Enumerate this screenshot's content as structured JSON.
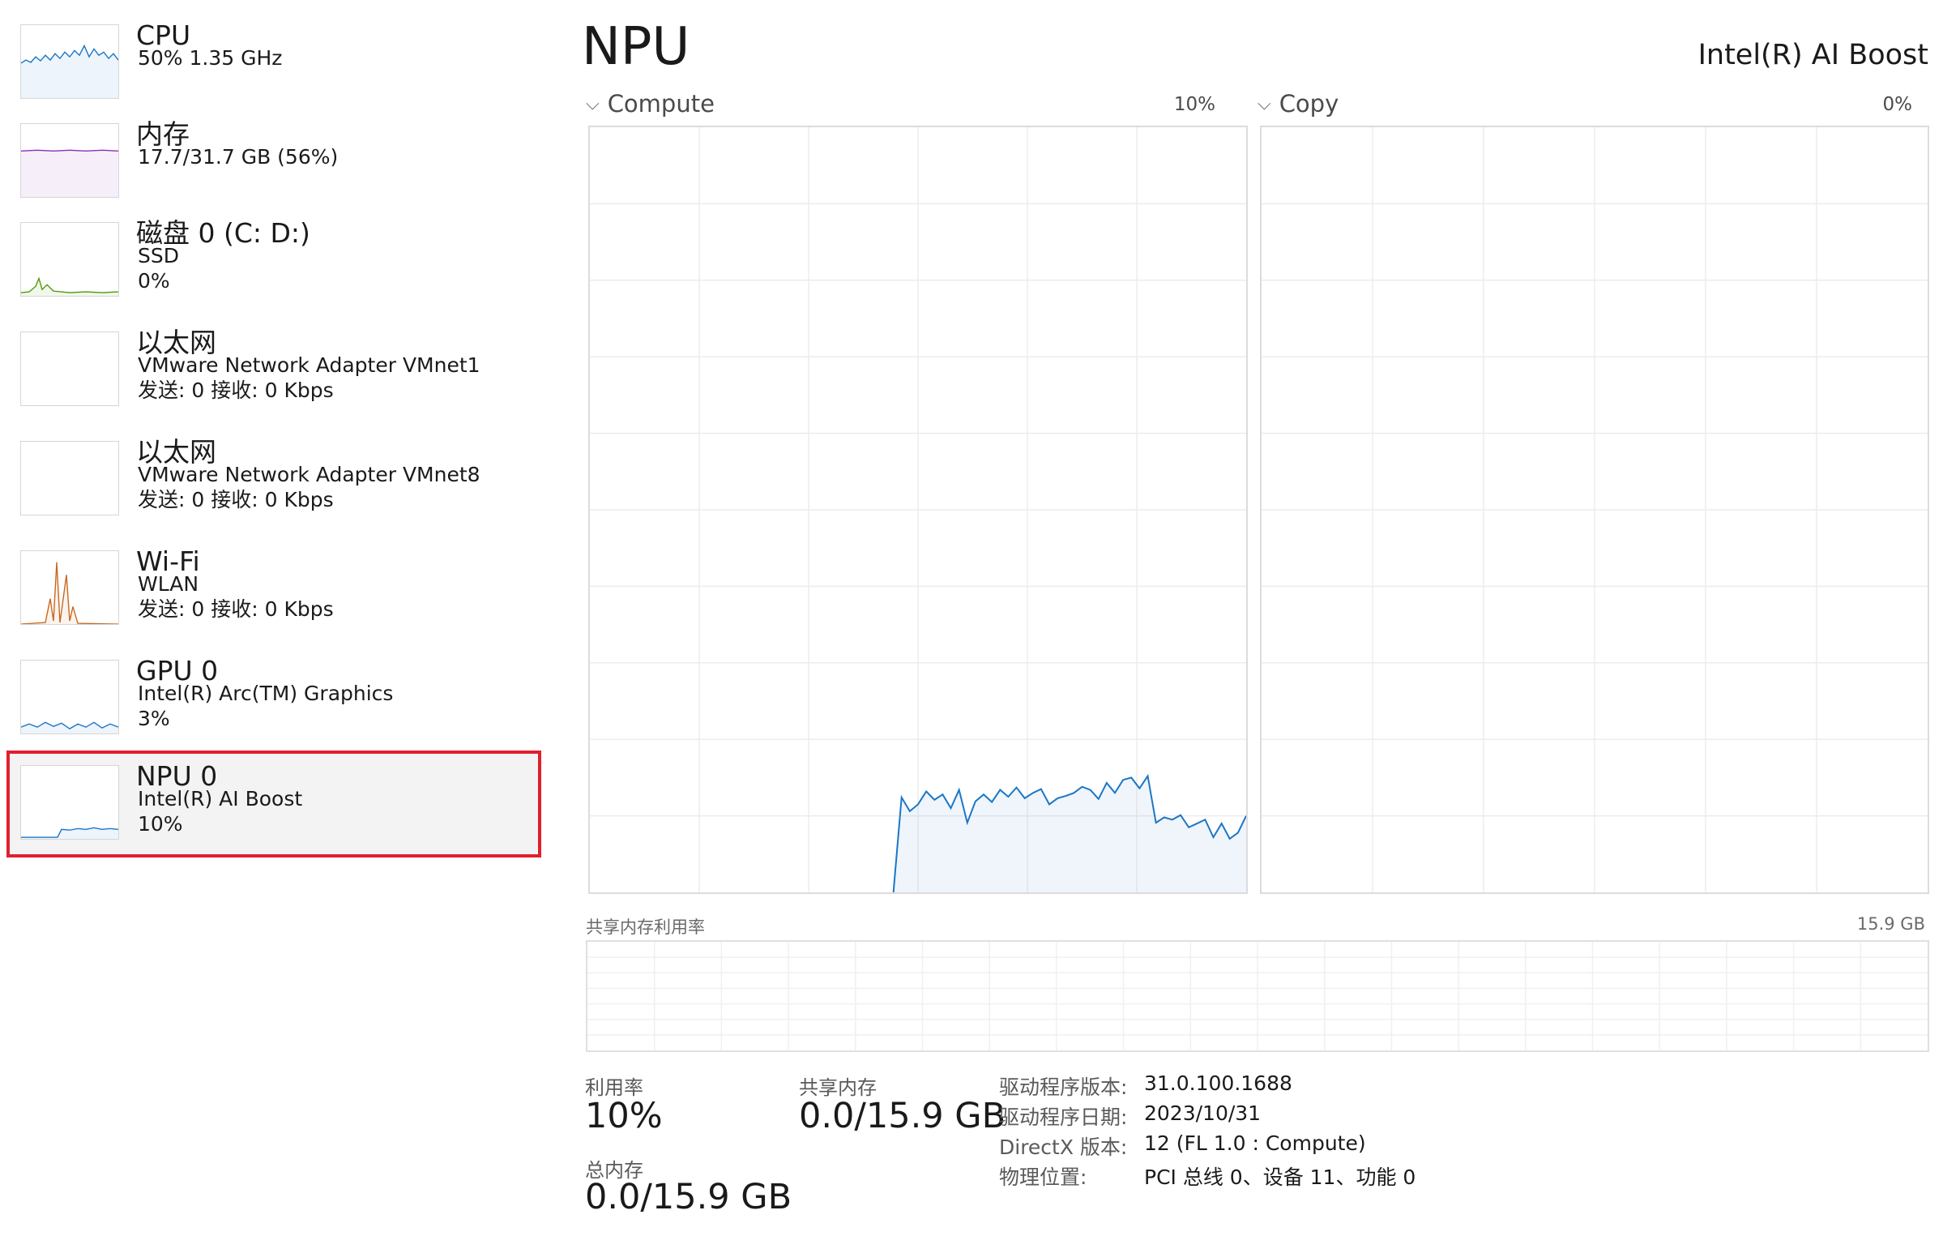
{
  "sidebar": {
    "items": [
      {
        "title": "CPU",
        "lines": [
          "50%  1.35 GHz"
        ],
        "color": "#1a76c7"
      },
      {
        "title": "内存",
        "lines": [
          "17.7/31.7 GB (56%)"
        ],
        "color": "#8b2fb8"
      },
      {
        "title": "磁盘 0 (C: D:)",
        "lines": [
          "SSD",
          "0%"
        ],
        "color": "#4e9a06"
      },
      {
        "title": "以太网",
        "lines": [
          "VMware Network Adapter VMnet1",
          "发送: 0 接收: 0 Kbps"
        ],
        "color": "#b5651d"
      },
      {
        "title": "以太网",
        "lines": [
          "VMware Network Adapter VMnet8",
          "发送: 0 接收: 0 Kbps"
        ],
        "color": "#b5651d"
      },
      {
        "title": "Wi-Fi",
        "lines": [
          "WLAN",
          "发送: 0 接收: 0 Kbps"
        ],
        "color": "#c8691e"
      },
      {
        "title": "GPU 0",
        "lines": [
          "Intel(R) Arc(TM) Graphics",
          "3%"
        ],
        "color": "#1a76c7"
      },
      {
        "title": "NPU 0",
        "lines": [
          "Intel(R) AI Boost",
          "10%"
        ],
        "color": "#1a76c7",
        "selected": true
      }
    ]
  },
  "main": {
    "title": "NPU",
    "device_name": "Intel(R) AI Boost",
    "graphs": [
      {
        "label": "Compute",
        "value": "10%"
      },
      {
        "label": "Copy",
        "value": "0%"
      }
    ],
    "shared_memory_label": "共享内存利用率",
    "shared_memory_max": "15.9 GB",
    "stats": {
      "utilization_label": "利用率",
      "utilization_value": "10%",
      "shared_memory_label": "共享内存",
      "shared_memory_value": "0.0/15.9 GB",
      "total_memory_label": "总内存",
      "total_memory_value": "0.0/15.9 GB"
    },
    "info": [
      {
        "label": "驱动程序版本:",
        "value": "31.0.100.1688"
      },
      {
        "label": "驱动程序日期:",
        "value": "2023/10/31"
      },
      {
        "label": "DirectX 版本:",
        "value": "12 (FL 1.0 : Compute)"
      },
      {
        "label": "物理位置:",
        "value": "PCI 总线 0、设备 11、功能 0"
      }
    ]
  },
  "chart_data": {
    "type": "area",
    "title": "Compute",
    "ylim": [
      0,
      100
    ],
    "series": [
      {
        "values": [
          0,
          0,
          0,
          0,
          0,
          0,
          0,
          0,
          0,
          0,
          0,
          0,
          0,
          0,
          0,
          0,
          0,
          0,
          0,
          0,
          0,
          0,
          0,
          0,
          0,
          0,
          0,
          0,
          0,
          0,
          0,
          0,
          0,
          0,
          0,
          0,
          0,
          0,
          12.4,
          10.6,
          11.5,
          13.2,
          12.1,
          12.8,
          11.0,
          13.4,
          9.1,
          11.9,
          12.8,
          11.8,
          13.4,
          12.5,
          13.7,
          12.3,
          13.0,
          13.5,
          11.5,
          12.3,
          12.6,
          13.0,
          13.8,
          13.4,
          12.2,
          14.3,
          13.0,
          14.7,
          15.0,
          13.6,
          15.2,
          9.1,
          9.8,
          9.5,
          10.1,
          8.5,
          9.0,
          9.5,
          7.2,
          9.0,
          7.0,
          7.8,
          10.0
        ]
      }
    ],
    "grid": true,
    "color": "#1a76c7"
  }
}
